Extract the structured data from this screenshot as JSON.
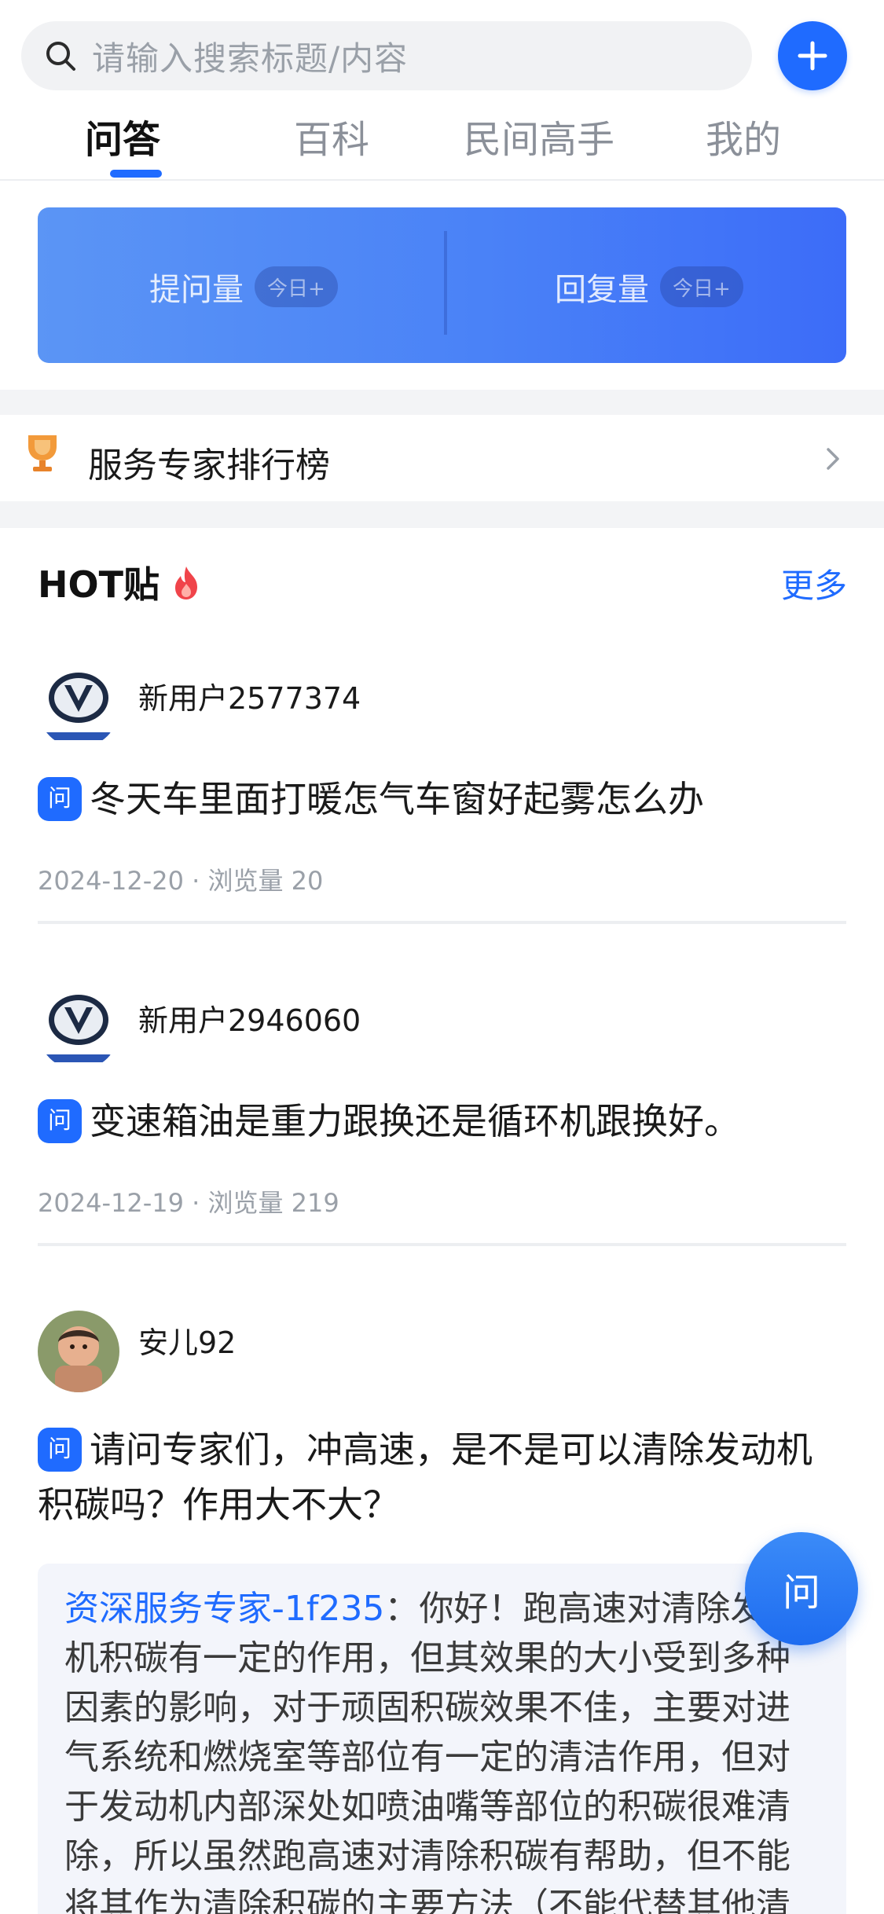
{
  "search": {
    "placeholder": "请输入搜索标题/内容"
  },
  "tabs": [
    {
      "label": "问答",
      "active": true
    },
    {
      "label": "百科",
      "active": false
    },
    {
      "label": "民间高手",
      "active": false
    },
    {
      "label": "我的",
      "active": false
    }
  ],
  "stats": [
    {
      "label": "提问量",
      "badge": "今日+"
    },
    {
      "label": "回复量",
      "badge": "今日+"
    }
  ],
  "ranking": {
    "title": "服务专家排行榜"
  },
  "hot": {
    "title": "HOT贴",
    "more": "更多"
  },
  "posts": [
    {
      "user": "新用户2577374",
      "question": "冬天车里面打暖怎气车窗好起雾怎么办",
      "date": "2024-12-20",
      "views": "浏览量 20"
    },
    {
      "user": "新用户2946060",
      "question": "变速箱油是重力跟换还是循环机跟换好。",
      "date": "2024-12-19",
      "views": "浏览量 219"
    },
    {
      "user": "安儿92",
      "question": "请问专家们，冲高速，是不是可以清除发动机积碳吗？作用大不大？"
    }
  ],
  "answer": {
    "author": "资深服务专家-1f235",
    "text": "：你好！跑高速对清除发动机积碳有一定的作用，但其效果的大小受到多种因素的影响，对于顽固积碳效果不佳，主要对进气系统和燃烧室等部位有一定的清洁作用，但对于发动机内部深处如喷油嘴等部位的积碳很难清除，所以虽然跑高速对清除积碳有帮助，但不能将其作为清除积碳的主要方法（不能代替其他清"
  },
  "badge_char": "问",
  "fab": {
    "label": "问"
  },
  "colors": {
    "accent": "#1f6bff",
    "banner_start": "#5b95f5",
    "banner_end": "#3c6cf8"
  }
}
